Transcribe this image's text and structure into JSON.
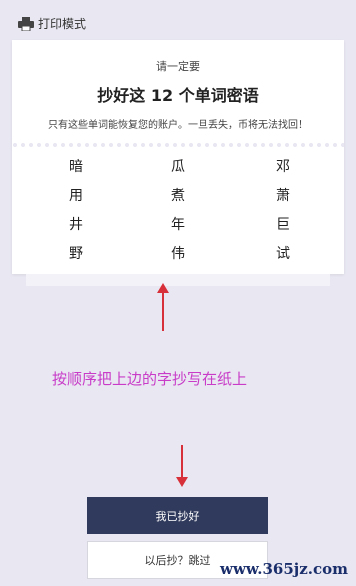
{
  "header": {
    "print_mode_label": "打印模式"
  },
  "card": {
    "subtitle": "请一定要",
    "title": "抄好这 12 个单词密语",
    "note": "只有这些单词能恢复您的账户。一旦丢失，币将无法找回！",
    "words": [
      "暗",
      "瓜",
      "邓",
      "用",
      "煮",
      "萧",
      "井",
      "年",
      "巨",
      "野",
      "伟",
      "试"
    ]
  },
  "annotation": {
    "text": "按顺序把上边的字抄写在纸上",
    "color": "#c83cc8",
    "arrow_color": "#d8303a"
  },
  "buttons": {
    "confirm_label": "我已抄好",
    "skip_label": "以后抄？跳过"
  },
  "watermark": {
    "text": "www.365jz.com"
  },
  "colors": {
    "background": "#e9e8f2",
    "primary_button": "#303a5c"
  }
}
